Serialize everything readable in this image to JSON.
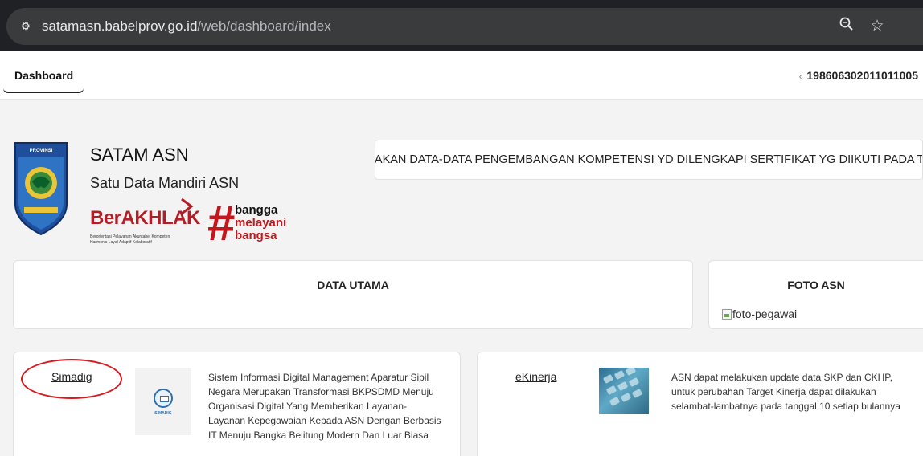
{
  "browser": {
    "url_host": "satamasn.babelprov.go.id",
    "url_path": "/web/dashboard/index"
  },
  "header": {
    "tab_dashboard": "Dashboard",
    "user_nip": "198606302011011005"
  },
  "brand": {
    "title": "SATAM ASN",
    "subtitle": "Satu Data Mandiri ASN",
    "berakhlak": "BerAKHLAK",
    "berakhlak_tagline_1": "Berorientasi Pelayanan Akuntabel Kompeten",
    "berakhlak_tagline_2": "Harmonis Loyal Adaptif Kolaboratif",
    "bangga_line1": "bangga",
    "bangga_line2": "melayani",
    "bangga_line3": "bangsa"
  },
  "announcement": {
    "text": "MEREMAJAKAN DATA-DATA PENGEMBANGAN KOMPETENSI YD DILENGKAPI SERTIFIKAT YG DIIKUTI PADA TAHUN"
  },
  "cards": {
    "data_utama_title": "DATA UTAMA",
    "foto_asn_title": "FOTO ASN",
    "foto_alt": "foto-pegawai"
  },
  "apps": [
    {
      "name": "Simadig",
      "description": "Sistem Informasi Digital Management Aparatur Sipil Negara Merupakan Transformasi BKPSDMD Menuju Organisasi Digital Yang Memberikan Layanan-Layanan Kepegawaian Kepada ASN Dengan Berbasis IT Menuju Bangka Belitung Modern Dan Luar Biasa",
      "thumb_caption": "SIMADIG"
    },
    {
      "name": "eKinerja",
      "description": "ASN dapat melakukan update data SKP dan CKHP, untuk perubahan Target Kinerja dapat dilakukan selambat-lambatnya pada tanggal 10 setiap bulannya"
    }
  ],
  "colors": {
    "accent_red": "#d71920",
    "brand_red": "#b11e25"
  }
}
